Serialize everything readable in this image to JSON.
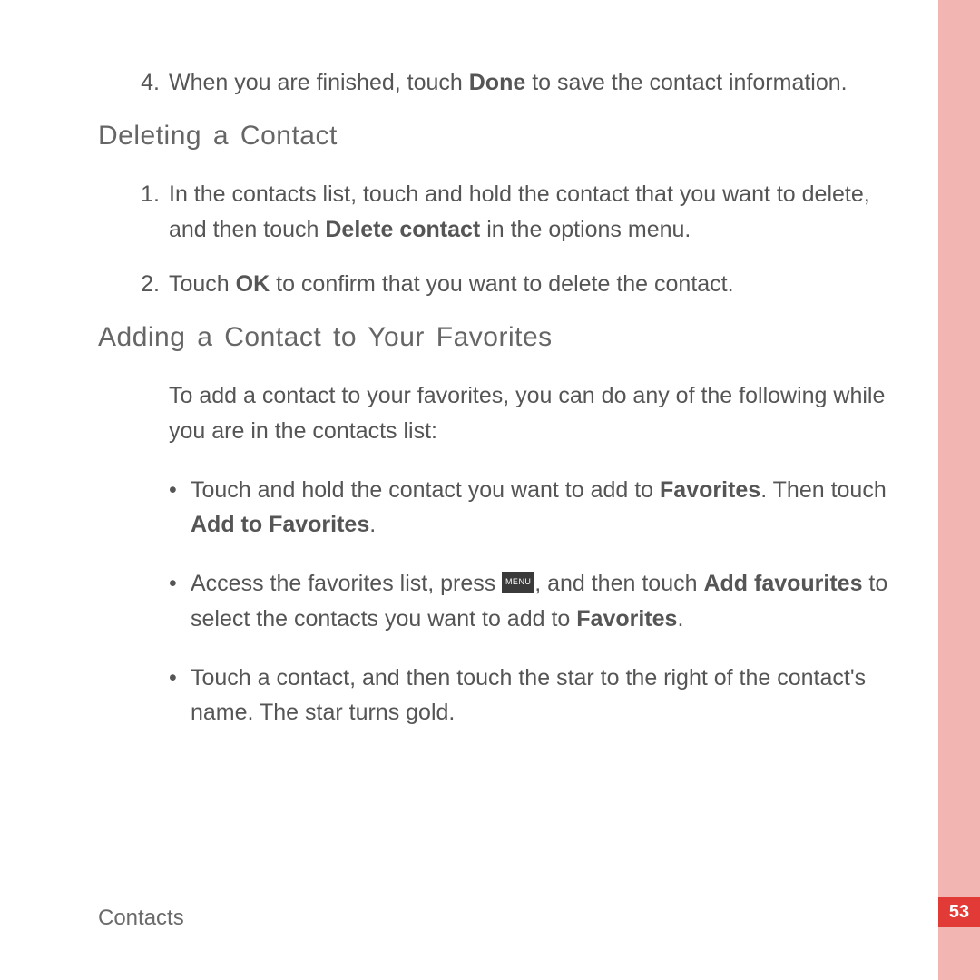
{
  "sideband": {
    "page_number": "53"
  },
  "intro_step": {
    "num": "4.",
    "pre": "When you are finished, touch ",
    "bold": "Done",
    "post": " to save the contact information."
  },
  "section_delete": {
    "heading": "Deleting a Contact",
    "step1": {
      "num": "1.",
      "pre": "In the contacts list, touch and hold the contact that you want to delete, and then touch ",
      "bold": "Delete contact",
      "post": " in the options menu."
    },
    "step2": {
      "num": "2.",
      "pre": "Touch ",
      "bold": "OK",
      "post": " to confirm that you want to delete the contact."
    }
  },
  "section_fav": {
    "heading": "Adding a Contact to Your Favorites",
    "intro": "To add a contact to your favorites, you can do any of the following while you are in the contacts list:",
    "b1": {
      "pre": "Touch and hold the contact you want to add to ",
      "bold1": "Favorites",
      "mid": ". Then touch ",
      "bold2": "Add to Favorites",
      "post": "."
    },
    "b2": {
      "pre": "Access the favorites list, press ",
      "icon_label": "MENU",
      "mid1": ", and then touch ",
      "bold1": "Add favourites",
      "mid2": " to select the contacts you want to add to ",
      "bold2": "Favorites",
      "post": "."
    },
    "b3": {
      "text": "Touch a contact, and then touch the star to the right of the contact's name. The star turns gold."
    }
  },
  "footer": {
    "section_label": "Contacts"
  },
  "bullet": "•"
}
